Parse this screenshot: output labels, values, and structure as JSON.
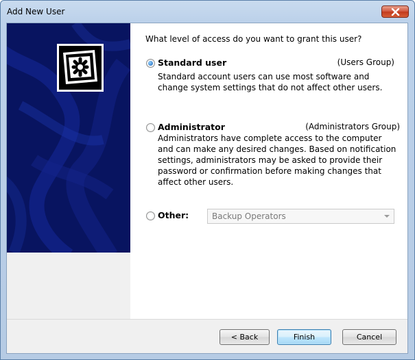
{
  "window": {
    "title": "Add New User"
  },
  "content": {
    "question": "What level of access do you want to grant this user?",
    "options": [
      {
        "label": "Standard user",
        "group": "(Users Group)",
        "description": [
          "Standard account users can use most software and",
          "change system settings that do not affect other users."
        ],
        "checked": true
      },
      {
        "label": "Administrator",
        "group": "(Administrators Group)",
        "description": [
          "Administrators have complete access to the computer",
          "and can make any desired changes. Based on notification",
          "settings, administrators may be asked to provide their",
          "password or confirmation before making changes that",
          "affect other users."
        ],
        "checked": false
      },
      {
        "label": "Other:",
        "checked": false,
        "select": {
          "value": "Backup Operators",
          "disabled": true
        }
      }
    ]
  },
  "buttons": {
    "back": "< Back",
    "finish": "Finish",
    "cancel": "Cancel"
  },
  "colors": {
    "banner": "#081460",
    "close_button": "#c9482b",
    "radio_selected": "#1a62b8"
  }
}
